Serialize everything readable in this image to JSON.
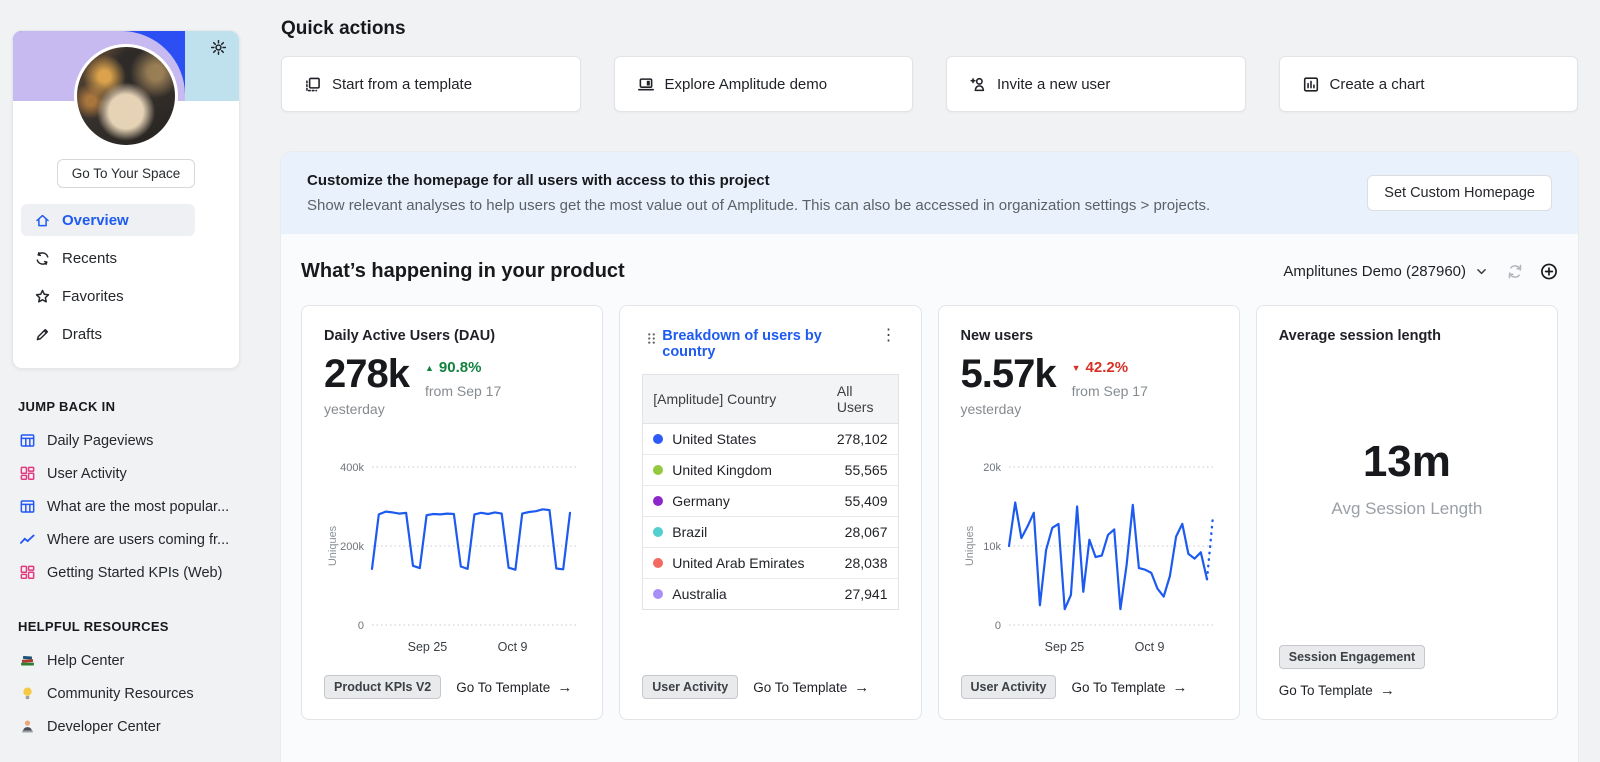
{
  "colors": {
    "accent": "#1e5bf0",
    "chart_line": "#1d5bf0",
    "green": "#13813f",
    "red": "#d93025",
    "banner_bg": "#e8f1fc",
    "header_purple": "#c6baf1",
    "header_blue": "#2b4ff2",
    "header_lightblue": "#bfe0ed"
  },
  "ui": {
    "arrow": "→"
  },
  "sidebar": {
    "go_to_space_label": "Go To Your Space",
    "nav": [
      {
        "icon": "home",
        "label": "Overview",
        "active": true
      },
      {
        "icon": "refresh",
        "label": "Recents",
        "active": false
      },
      {
        "icon": "star",
        "label": "Favorites",
        "active": false
      },
      {
        "icon": "pencil",
        "label": "Drafts",
        "active": false
      }
    ],
    "jump_back_in": {
      "heading": "JUMP BACK IN",
      "items": [
        {
          "icon": "table",
          "icon_color": "#2457f5",
          "label": "Daily Pageviews"
        },
        {
          "icon": "dashboard",
          "icon_color": "#e23a7f",
          "label": "User Activity"
        },
        {
          "icon": "table",
          "icon_color": "#2457f5",
          "label": "What are the most popular..."
        },
        {
          "icon": "line-chart",
          "icon_color": "#2457f5",
          "label": "Where are users coming fr..."
        },
        {
          "icon": "dashboard",
          "icon_color": "#e23a7f",
          "label": "Getting Started KPIs (Web)"
        }
      ]
    },
    "helpful_resources": {
      "heading": "HELPFUL RESOURCES",
      "items": [
        {
          "icon": "books",
          "label": "Help Center"
        },
        {
          "icon": "bulb",
          "label": "Community Resources"
        },
        {
          "icon": "person",
          "label": "Developer Center"
        }
      ]
    }
  },
  "quick_actions": {
    "heading": "Quick actions",
    "buttons": [
      {
        "icon": "template",
        "label": "Start from a template"
      },
      {
        "icon": "laptop",
        "label": "Explore Amplitude demo"
      },
      {
        "icon": "invite-user",
        "label": "Invite a new user"
      },
      {
        "icon": "bar-chart",
        "label": "Create a chart"
      }
    ]
  },
  "banner": {
    "title": "Customize the homepage for all users with access to this project",
    "subtitle": "Show relevant analyses to help users get the most value out of Amplitude. This can also be accessed in organization settings > projects.",
    "button_label": "Set Custom Homepage"
  },
  "section": {
    "heading": "What’s happening in your product",
    "project_selector": "Amplitunes Demo (287960)"
  },
  "cards": {
    "dau": {
      "title": "Daily Active Users (DAU)",
      "value": "278k",
      "value_caption": "yesterday",
      "delta_icon": "▲",
      "delta": "90.8%",
      "delta_caption": "from Sep 17",
      "tag": "Product KPIs V2",
      "link": "Go To Template"
    },
    "breakdown": {
      "title": "Breakdown of users by country",
      "table": {
        "col1": "[Amplitude] Country",
        "col2": "All Users",
        "rows": [
          {
            "color": "#2e5bf7",
            "country": "United States",
            "value": "278,102"
          },
          {
            "color": "#94c83d",
            "country": "United Kingdom",
            "value": "55,565"
          },
          {
            "color": "#8b28c9",
            "country": "Germany",
            "value": "55,409"
          },
          {
            "color": "#52cfcf",
            "country": "Brazil",
            "value": "28,067"
          },
          {
            "color": "#f4695f",
            "country": "United Arab Emirates",
            "value": "28,038"
          },
          {
            "color": "#a88ff7",
            "country": "Australia",
            "value": "27,941"
          }
        ]
      },
      "tag": "User Activity",
      "link": "Go To Template"
    },
    "new_users": {
      "title": "New users",
      "value": "5.57k",
      "value_caption": "yesterday",
      "delta_icon": "▼",
      "delta": "42.2%",
      "delta_caption": "from Sep 17",
      "tag": "User Activity",
      "link": "Go To Template"
    },
    "session": {
      "title": "Average session length",
      "value": "13m",
      "value_caption": "Avg Session Length",
      "tag": "Session Engagement",
      "link": "Go To Template"
    }
  },
  "chart_data": [
    {
      "id": "dau",
      "type": "line",
      "title": "Daily Active Users (DAU)",
      "ylabel": "Uniques",
      "unit": "thousands",
      "ylim": [
        0,
        400
      ],
      "yticks": [
        {
          "v": 400,
          "label": "400k"
        },
        {
          "v": 200,
          "label": "200k"
        },
        {
          "v": 0,
          "label": "0"
        }
      ],
      "xticks": [
        {
          "pos": 0.28,
          "label": "Sep 25"
        },
        {
          "pos": 0.71,
          "label": "Oct 9"
        }
      ],
      "color": "#1d5bf0",
      "values": [
        142,
        280,
        287,
        285,
        282,
        284,
        150,
        144,
        278,
        281,
        280,
        282,
        281,
        148,
        142,
        280,
        284,
        281,
        285,
        282,
        145,
        140,
        282,
        286,
        288,
        293,
        291,
        143,
        141,
        284
      ]
    },
    {
      "id": "new_users",
      "type": "line",
      "title": "New users",
      "ylabel": "Uniques",
      "unit": "thousands",
      "ylim": [
        0,
        20
      ],
      "yticks": [
        {
          "v": 20,
          "label": "20k"
        },
        {
          "v": 10,
          "label": "10k"
        },
        {
          "v": 0,
          "label": "0"
        }
      ],
      "xticks": [
        {
          "pos": 0.28,
          "label": "Sep 25"
        },
        {
          "pos": 0.71,
          "label": "Oct 9"
        }
      ],
      "color": "#1d5bf0",
      "values": [
        10,
        15.5,
        11,
        12.5,
        14.2,
        2.5,
        9.5,
        12.3,
        12.8,
        2,
        3.8,
        15,
        4.2,
        10.8,
        8.6,
        8.8,
        11.4,
        12.1,
        2,
        7.6,
        15.2,
        7.2,
        7,
        6.6,
        4.6,
        3.6,
        6.2,
        11.2,
        12.8,
        9,
        8.4,
        9.2,
        5.8
      ],
      "projection": 13.8
    }
  ]
}
